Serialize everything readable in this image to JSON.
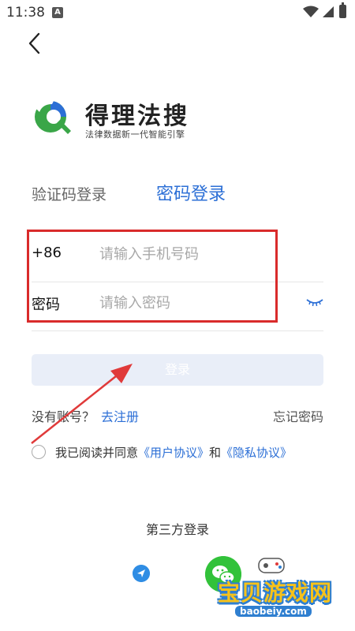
{
  "status_bar": {
    "time": "11:38",
    "notification_badge": "A"
  },
  "header": {
    "app_name": "得理法搜",
    "slogan": "法律数据新一代智能引擎"
  },
  "tabs": {
    "sms_login": "验证码登录",
    "password_login": "密码登录"
  },
  "form": {
    "phone_prefix": "+86",
    "phone_placeholder": "请输入手机号码",
    "password_label": "密码",
    "password_placeholder": "请输入密码"
  },
  "actions": {
    "login": "登录",
    "no_account": "没有账号？",
    "register": "去注册",
    "forgot_password": "忘记密码"
  },
  "agreement": {
    "prefix": "我已阅读并同意",
    "user_agreement": "《用户协议》",
    "and": "和",
    "privacy_agreement": "《隐私协议》"
  },
  "third_party": {
    "title": "第三方登录"
  },
  "watermark": {
    "site": "宝贝游戏网",
    "url": "baobeiy.com"
  },
  "colors": {
    "accent": "#2c6fd6",
    "highlight": "#d92b2b",
    "login_bg": "#e9eef8",
    "wechat": "#32c23a"
  },
  "icons": [
    "back-icon",
    "wifi-icon",
    "signal-icon",
    "battery-icon",
    "eye-closed-icon",
    "wechat-icon",
    "paper-plane-icon"
  ]
}
